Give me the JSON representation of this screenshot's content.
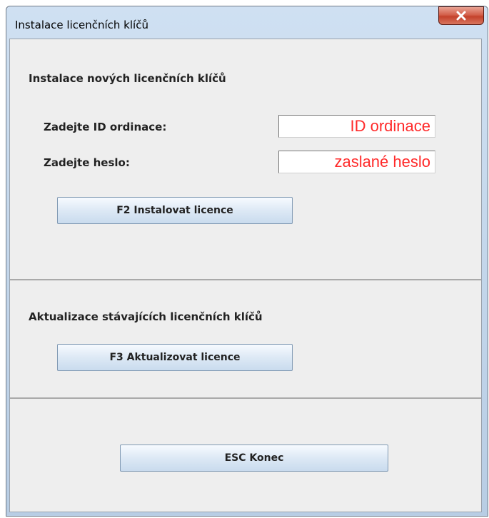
{
  "window": {
    "title": "Instalace licenčních klíčů",
    "close_icon": "close-icon"
  },
  "install": {
    "heading": "Instalace nových licenčních klíčů",
    "id_label": "Zadejte ID ordinace:",
    "id_value": "ID ordinace",
    "password_label": "Zadejte heslo:",
    "password_value": "zaslané heslo",
    "install_button": "F2 Instalovat licence"
  },
  "update": {
    "heading": "Aktualizace stávajících licenčních klíčů",
    "update_button": "F3 Aktualizovat licence"
  },
  "footer": {
    "end_button": "ESC Konec"
  },
  "colors": {
    "field_text": "#ff2a2a",
    "close_button": "#c4412b"
  }
}
